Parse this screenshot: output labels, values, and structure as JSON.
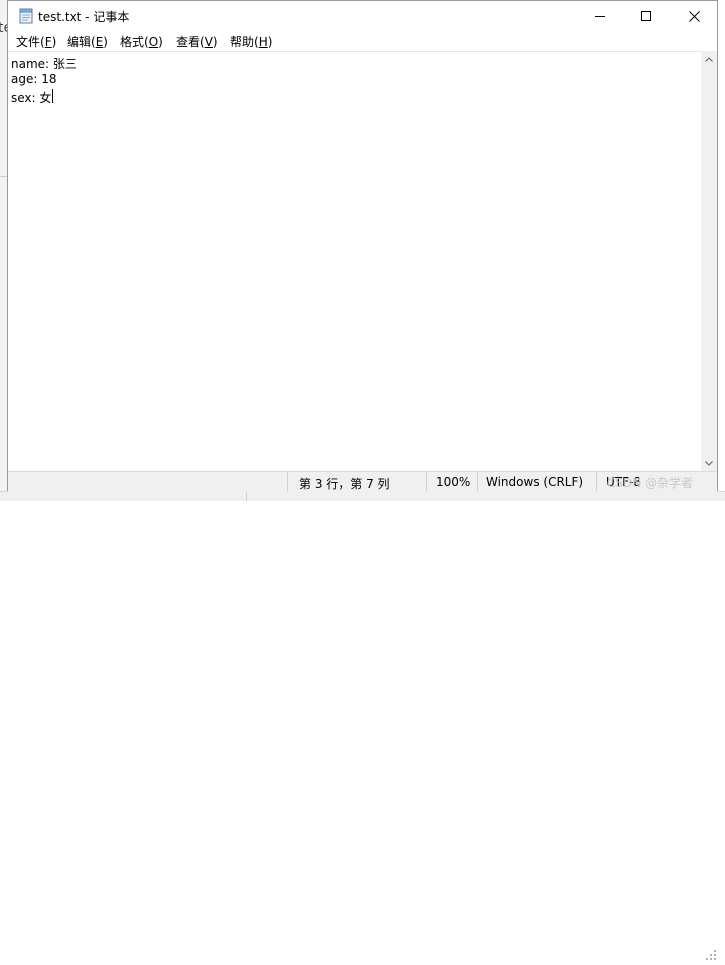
{
  "window": {
    "title": "test.txt - 记事本",
    "icon": "notepad-icon",
    "controls": {
      "minimize": "minimize-icon",
      "maximize": "maximize-icon",
      "close": "close-icon"
    }
  },
  "menu": {
    "items": [
      {
        "label": "文件",
        "accel": "F"
      },
      {
        "label": "编辑",
        "accel": "E"
      },
      {
        "label": "格式",
        "accel": "O"
      },
      {
        "label": "查看",
        "accel": "V"
      },
      {
        "label": "帮助",
        "accel": "H"
      }
    ]
  },
  "editor": {
    "lines": [
      "name: 张三",
      "age: 18",
      "sex: 女"
    ]
  },
  "status": {
    "position": "第 3 行，第 7 列",
    "zoom": "100%",
    "line_ending": "Windows (CRLF)",
    "encoding": "UTF-8"
  },
  "background": {
    "fragment": "te"
  },
  "watermark": "CSDN @杂学者"
}
